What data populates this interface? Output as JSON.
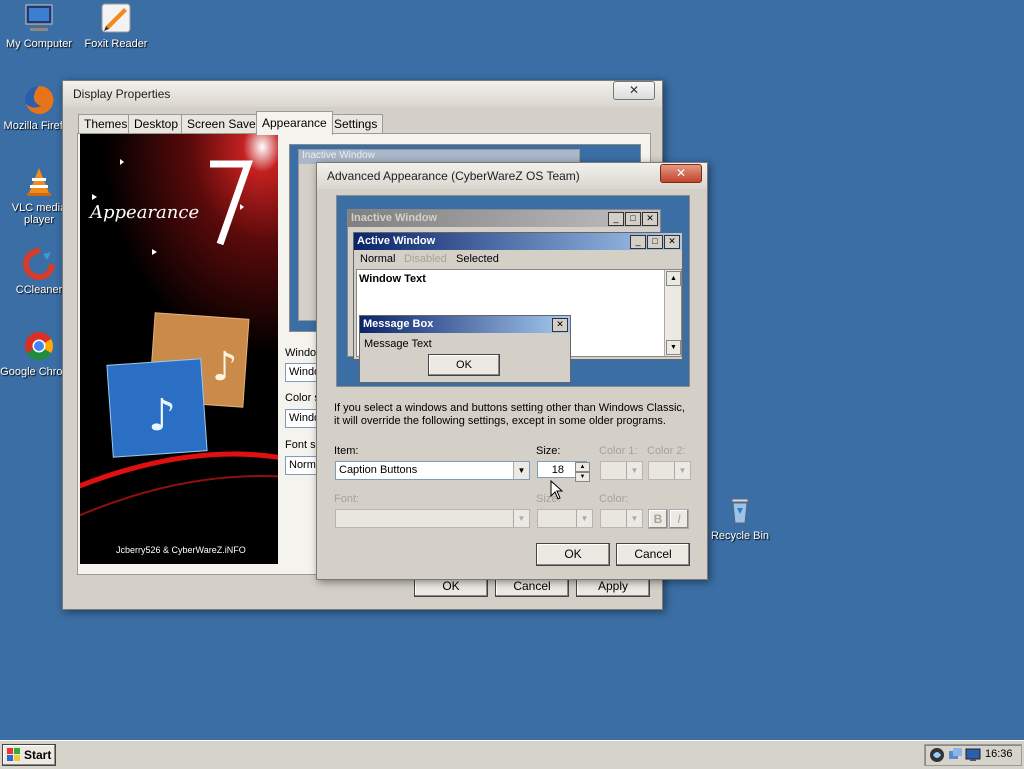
{
  "desktop": {
    "icons": [
      {
        "label": "My Computer"
      },
      {
        "label": "Foxit Reader"
      },
      {
        "label": "Mozilla Firefox"
      },
      {
        "label_line1": "VLC media",
        "label_line2": "player"
      },
      {
        "label": "CCleaner"
      },
      {
        "label": "Google Chrome"
      },
      {
        "label": "Recycle Bin"
      }
    ]
  },
  "display_properties": {
    "title": "Display Properties",
    "close_glyph": "✕",
    "tabs": [
      "Themes",
      "Desktop",
      "Screen Saver",
      "Appearance",
      "Settings"
    ],
    "active_tab": "Appearance",
    "banner": {
      "title": "Appearance",
      "credit": "Jcberry526 & CyberWareZ.iNFO"
    },
    "partial_labels": [
      "Window",
      "Windo",
      "Color sc",
      "Windo",
      "Font siz",
      "Normal"
    ],
    "buttons": {
      "ok": "OK",
      "cancel": "Cancel",
      "apply": "Apply"
    },
    "preview_partial_title": "Inactive Window"
  },
  "advanced_appearance": {
    "title": "Advanced Appearance (CyberWareZ OS Team)",
    "close_glyph": "✕",
    "preview": {
      "inactive_title": "Inactive Window",
      "active_title": "Active Window",
      "menu": {
        "normal": "Normal",
        "disabled": "Disabled",
        "selected": "Selected"
      },
      "window_text": "Window Text",
      "message_box": {
        "title": "Message Box",
        "text": "Message Text",
        "ok": "OK"
      }
    },
    "info_line1": "If you select a windows and buttons setting other than Windows Classic,",
    "info_line2": "it will override the following settings, except in some older programs.",
    "item_label": "Item:",
    "item_value": "Caption Buttons",
    "size_label": "Size:",
    "size_value": "18",
    "color1_label": "Color 1:",
    "color2_label": "Color 2:",
    "font_label": "Font:",
    "font_size_label": "Size:",
    "font_color_label": "Color:",
    "bold_label": "B",
    "italic_label": "I",
    "ok": "OK",
    "cancel": "Cancel"
  },
  "taskbar": {
    "start_label": "Start",
    "clock": "16:36"
  }
}
